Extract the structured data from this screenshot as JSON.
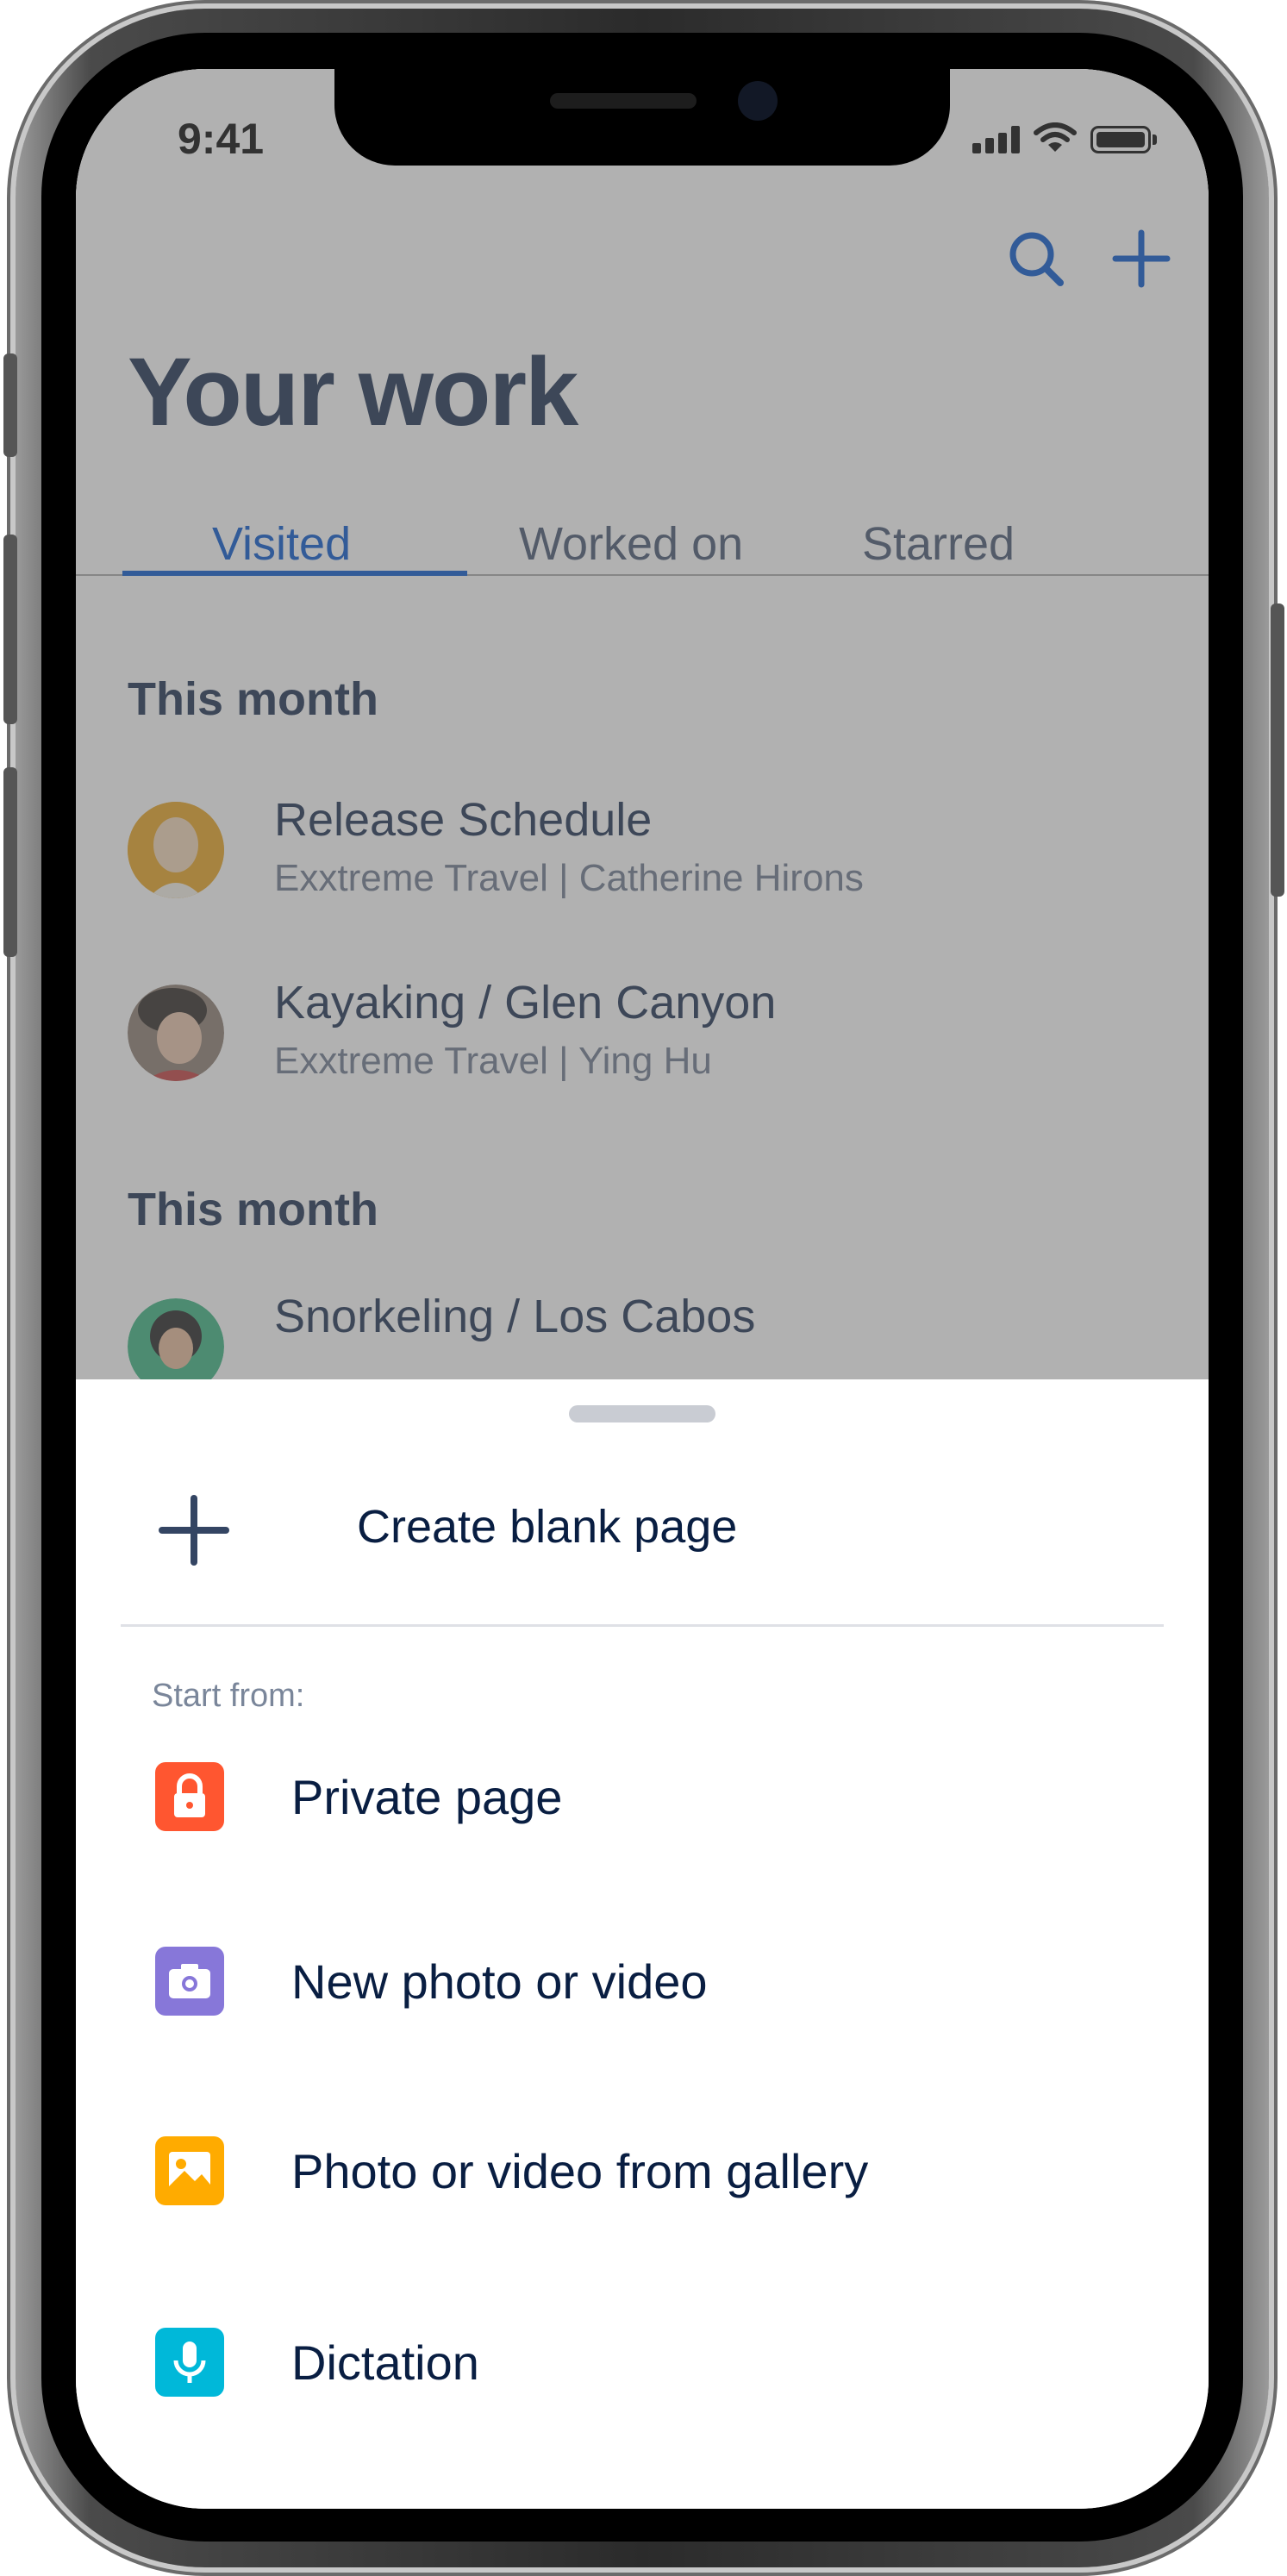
{
  "status_bar": {
    "time": "9:41"
  },
  "header": {
    "title": "Your work",
    "search_icon": "search-icon",
    "add_icon": "plus-icon",
    "accent_color": "#0052CC"
  },
  "tabs": [
    {
      "label": "Visited",
      "active": true
    },
    {
      "label": "Worked on",
      "active": false
    },
    {
      "label": "Starred",
      "active": false
    }
  ],
  "sections": [
    {
      "heading": "This month",
      "items": [
        {
          "title": "Release Schedule",
          "space": "Exxtreme Travel",
          "author": "Catherine Hirons",
          "subtitle": "Exxtreme Travel | Catherine Hirons"
        },
        {
          "title": "Kayaking / Glen Canyon",
          "space": "Exxtreme Travel",
          "author": "Ying Hu",
          "subtitle": "Exxtreme Travel | Ying Hu"
        }
      ]
    },
    {
      "heading": "This month",
      "items": [
        {
          "title": "Snorkeling / Los Cabos"
        }
      ]
    }
  ],
  "sheet": {
    "create_label": "Create blank page",
    "start_from_label": "Start from:",
    "options": [
      {
        "label": "Private page",
        "icon": "lock-icon",
        "color": "#FF5630"
      },
      {
        "label": "New photo or video",
        "icon": "camera-icon",
        "color": "#8777D9"
      },
      {
        "label": "Photo or video from gallery",
        "icon": "image-icon",
        "color": "#FFAB00"
      },
      {
        "label": "Dictation",
        "icon": "microphone-icon",
        "color": "#00B8D9"
      }
    ]
  }
}
